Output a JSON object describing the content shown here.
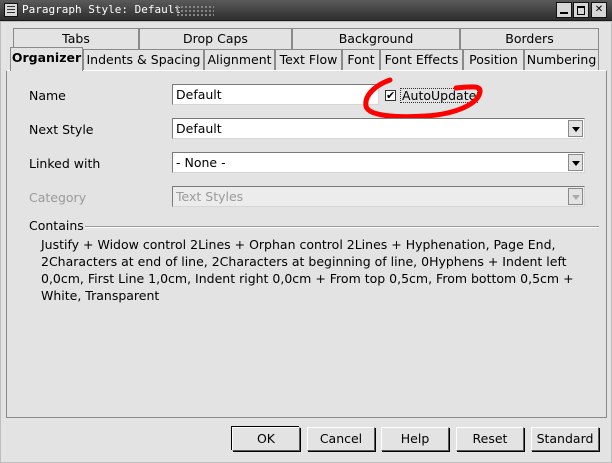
{
  "window": {
    "title": "Paragraph Style: Default"
  },
  "tabs": {
    "row1": [
      "Tabs",
      "Drop Caps",
      "Background",
      "Borders"
    ],
    "row2": [
      "Organizer",
      "Indents & Spacing",
      "Alignment",
      "Text Flow",
      "Font",
      "Font Effects",
      "Position",
      "Numbering"
    ],
    "active": "Organizer"
  },
  "organizer": {
    "name_label": "Name",
    "name_value": "Default",
    "autoupdate_label": "AutoUpdate",
    "autoupdate_checked": true,
    "autoupdate_mark": "✔",
    "next_style_label": "Next Style",
    "next_style_value": "Default",
    "linked_with_label": "Linked with",
    "linked_with_value": "- None -",
    "category_label": "Category",
    "category_value": "Text Styles",
    "contains_title": "Contains",
    "contains_text": "Justify + Widow control 2Lines + Orphan control 2Lines + Hyphenation, Page End, 2Characters at end of line, 2Characters at beginning of line, 0Hyphens + Indent left 0,0cm, First Line 1,0cm, Indent right 0,0cm + From top 0,5cm, From bottom 0,5cm + White, Transparent"
  },
  "buttons": {
    "ok": "OK",
    "cancel": "Cancel",
    "help": "Help",
    "reset": "Reset",
    "standard": "Standard"
  },
  "colors": {
    "annotation": "#ff0000",
    "dialog_bg": "#e3e3e3",
    "titlebar": "#3c3c3c"
  }
}
